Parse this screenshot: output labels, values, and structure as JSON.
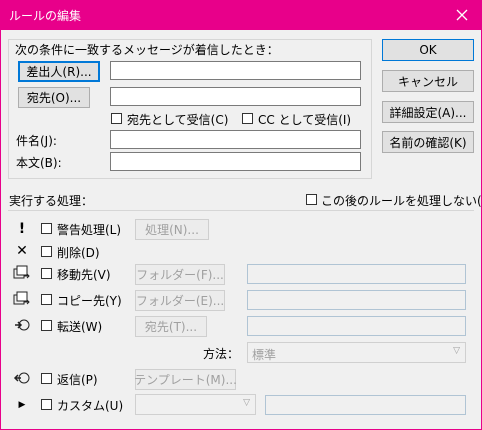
{
  "window": {
    "title": "ルールの編集",
    "close_glyph": "✕",
    "accent_color": "#e8008a"
  },
  "conditions": {
    "header": "次の条件に一致するメッセージが着信したとき：",
    "from_button": "差出人(R)...",
    "to_button": "宛先(O)...",
    "sent_to_me_label": "宛先として受信(C)",
    "cc_to_me_label": "CC として受信(I)",
    "subject_label": "件名(J):",
    "body_label": "本文(B):"
  },
  "right_buttons": {
    "ok": "OK",
    "cancel": "キャンセル",
    "advanced": "詳細設定(A)...",
    "check_names": "名前の確認(K)"
  },
  "actions": {
    "header": "実行する処理：",
    "stop_processing_label": "この後のルールを処理しない(S)",
    "alert": {
      "icon_glyph": "!",
      "label": "警告処理(L)",
      "button": "処理(N)..."
    },
    "delete": {
      "icon_glyph": "✕",
      "label": "削除(D)"
    },
    "move": {
      "label": "移動先(V)",
      "button": "フォルダー(F)..."
    },
    "copy": {
      "label": "コピー先(Y)",
      "button": "フォルダー(E)..."
    },
    "forward": {
      "label": "転送(W)",
      "button": "宛先(T)...",
      "method_label": "方法：",
      "method_value": "標準"
    },
    "reply": {
      "label": "返信(P)",
      "button": "テンプレート(M)..."
    },
    "custom": {
      "icon_glyph": "▶",
      "label": "カスタム(U)"
    }
  }
}
